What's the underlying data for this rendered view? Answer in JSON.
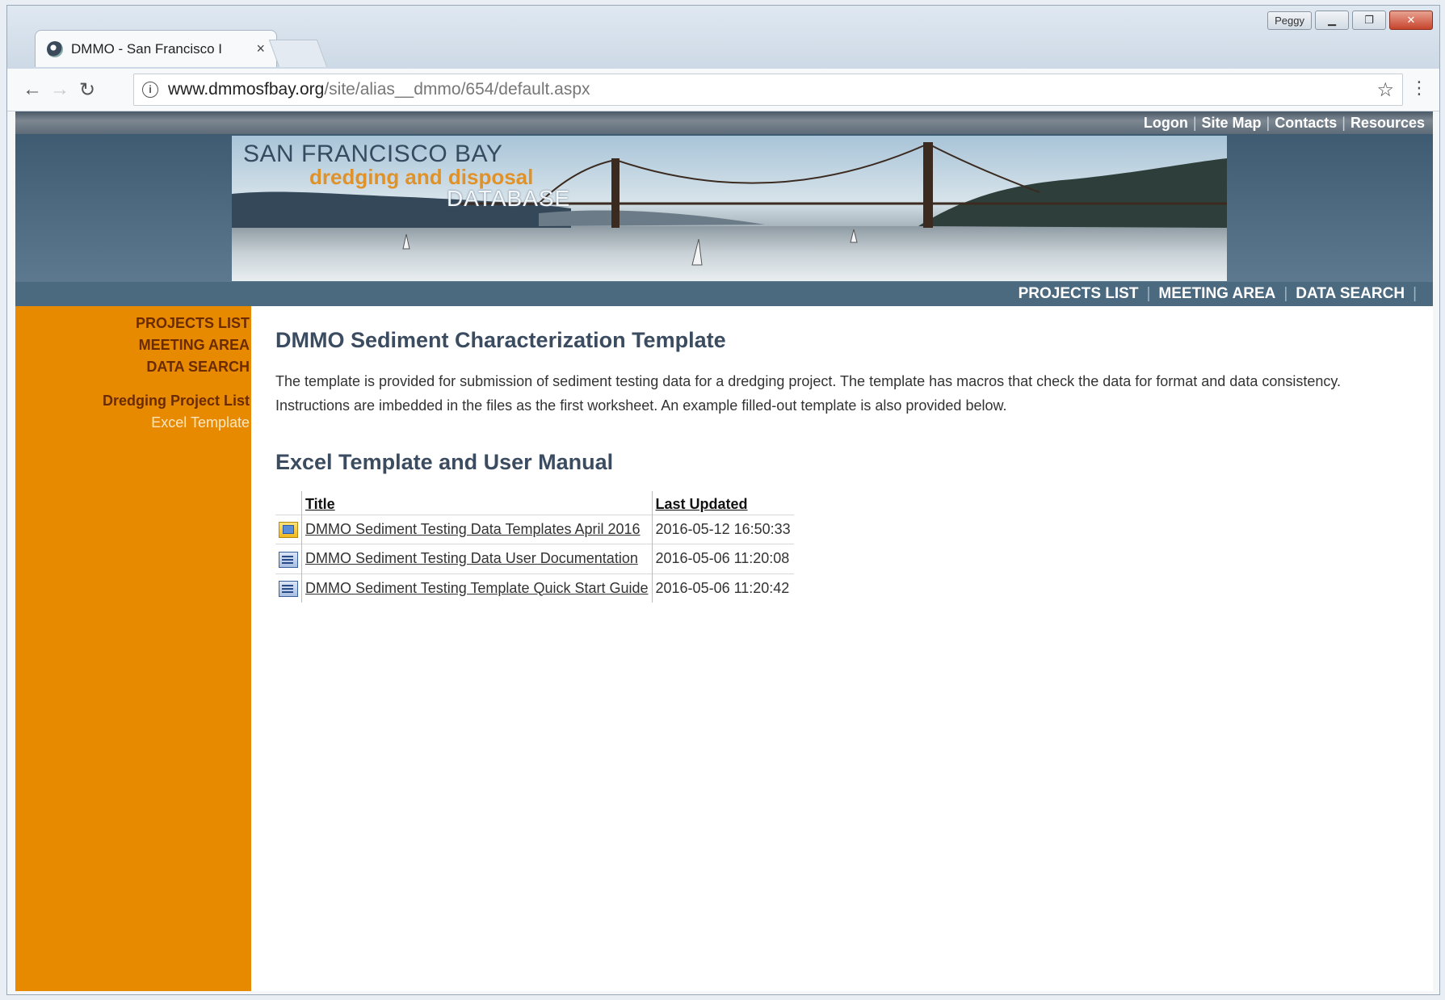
{
  "browser": {
    "tab_title": "DMMO - San Francisco I",
    "tab_close": "×",
    "url_host": "www.dmmosfbay.org",
    "url_path": "/site/alias__dmmo/654/default.aspx",
    "user_badge": "Peggy"
  },
  "top_links": [
    "Logon",
    "Site Map",
    "Contacts",
    "Resources"
  ],
  "banner": {
    "line1": "SAN FRANCISCO BAY",
    "line2": "dredging and disposal",
    "line3": "DATABASE"
  },
  "main_nav": [
    "PROJECTS LIST",
    "MEETING AREA",
    "DATA SEARCH"
  ],
  "sidebar": {
    "primary": [
      "PROJECTS LIST",
      "MEETING AREA",
      "DATA SEARCH"
    ],
    "section": "Dredging Project List",
    "current": "Excel Template"
  },
  "content": {
    "title": "DMMO Sediment Characterization Template",
    "intro": "The template is provided for submission of sediment testing data for a dredging project.  The template has macros that check the data for format and data consistency.  Instructions are imbedded in the files as the first worksheet.  An example filled-out template is also provided below.",
    "section_title": "Excel Template and User Manual",
    "table": {
      "headers": [
        "Title",
        "Last Updated"
      ],
      "rows": [
        {
          "icon": "presentation-file-icon",
          "title": "DMMO Sediment Testing Data Templates April 2016",
          "updated": "2016-05-12 16:50:33"
        },
        {
          "icon": "document-file-icon",
          "title": "DMMO Sediment Testing Data User Documentation",
          "updated": "2016-05-06 11:20:08"
        },
        {
          "icon": "document-file-icon",
          "title": "DMMO Sediment Testing Template Quick Start Guide",
          "updated": "2016-05-06 11:20:42"
        }
      ]
    }
  }
}
